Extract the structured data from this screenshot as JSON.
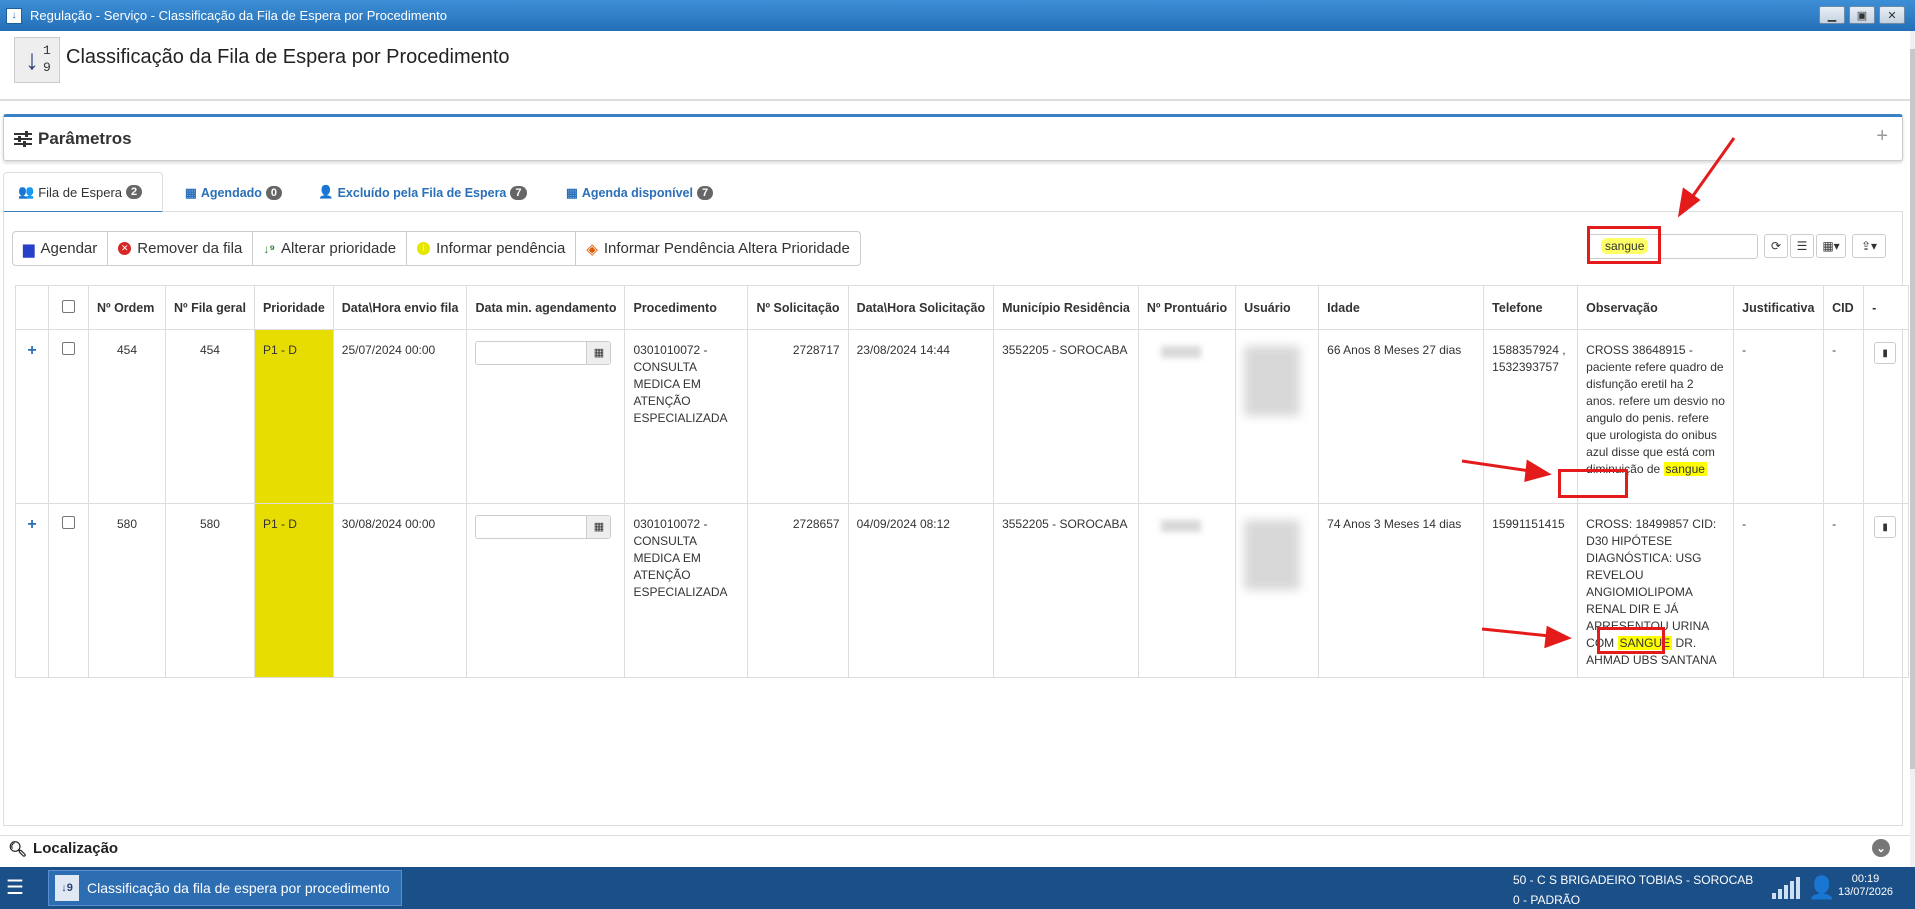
{
  "window": {
    "title": "Regulação - Serviço - Classificação da Fila de Espera por Procedimento",
    "min": "▭",
    "max": "◻",
    "close": "✕"
  },
  "header": {
    "title": "Classificação da Fila de Espera por Procedimento",
    "icon_digits": "1\n9"
  },
  "params": {
    "title": "Parâmetros",
    "expand": "+"
  },
  "tabs": [
    {
      "label": "Fila de Espera",
      "count": "2",
      "active": true,
      "icon": "users-icon"
    },
    {
      "label": "Agendado",
      "count": "0",
      "active": false,
      "icon": "calendar-check-icon"
    },
    {
      "label": "Excluído pela Fila de Espera",
      "count": "7",
      "active": false,
      "icon": "user-minus-icon"
    },
    {
      "label": "Agenda disponível",
      "count": "7",
      "active": false,
      "icon": "calendar-icon"
    }
  ],
  "toolbar": {
    "agendar": "Agendar",
    "remover": "Remover da fila",
    "alterar": "Alterar prioridade",
    "informar": "Informar pendência",
    "informar_altera": "Informar Pendência Altera Prioridade"
  },
  "search": {
    "value": "sangue"
  },
  "table": {
    "headers": [
      "Nº Ordem",
      "Nº Fila geral",
      "Prioridade",
      "Data\\Hora envio fila",
      "Data min. agendamento",
      "Procedimento",
      "Nº Solicitação",
      "Data\\Hora Solicitação",
      "Município Residência",
      "Nº Prontuário",
      "Usuário",
      "Idade",
      "Telefone",
      "Observação",
      "Justificativa",
      "CID",
      "-"
    ],
    "rows": [
      {
        "ordem": "454",
        "fila_geral": "454",
        "prioridade": "P1 - D",
        "envio": "25/07/2024 00:00",
        "procedimento": "0301010072 - CONSULTA MEDICA EM ATENÇÃO ESPECIALIZADA",
        "solicitacao": "2728717",
        "data_solicitacao": "23/08/2024 14:44",
        "municipio": "3552205 - SOROCABA",
        "idade": "66 Anos 8 Meses 27 dias",
        "telefone": "1588357924 , 1532393757",
        "obs_before": "CROSS 38648915 - paciente refere quadro de disfunção eretil ha 2 anos. refere um desvio no angulo do penis. refere que urologista do onibus azul disse que está com diminuição de ",
        "obs_hl": "sangue",
        "obs_after": "",
        "justificativa": "-",
        "cid": "-"
      },
      {
        "ordem": "580",
        "fila_geral": "580",
        "prioridade": "P1 - D",
        "envio": "30/08/2024 00:00",
        "procedimento": "0301010072 - CONSULTA MEDICA EM ATENÇÃO ESPECIALIZADA",
        "solicitacao": "2728657",
        "data_solicitacao": "04/09/2024 08:12",
        "municipio": "3552205 - SOROCABA",
        "idade": "74 Anos 3 Meses 14 dias",
        "telefone": "15991151415",
        "obs_before": "CROSS: 18499857 CID: D30 HIPÓTESE DIAGNÓSTICA: USG REVELOU ANGIOMIOLIPOMA RENAL DIR E JÁ APRESENTOU URINA COM ",
        "obs_hl": "SANGUE",
        "obs_after": " DR. AHMAD UBS SANTANA",
        "justificativa": "-",
        "cid": "-"
      }
    ]
  },
  "localizacao": {
    "label": "Localização"
  },
  "taskbar": {
    "task_label": "Classificação da fila de espera por procedimento",
    "unit": "50 - C S BRIGADEIRO TOBIAS - SOROCAB",
    "profile": "0 - PADRÃO",
    "time": "00:19",
    "date": "13/07/2026"
  },
  "colors": {
    "priority": "#e8dd00",
    "highlight": "#ffff00",
    "annotation": "#e31b1b",
    "accent": "#3b82c4"
  }
}
